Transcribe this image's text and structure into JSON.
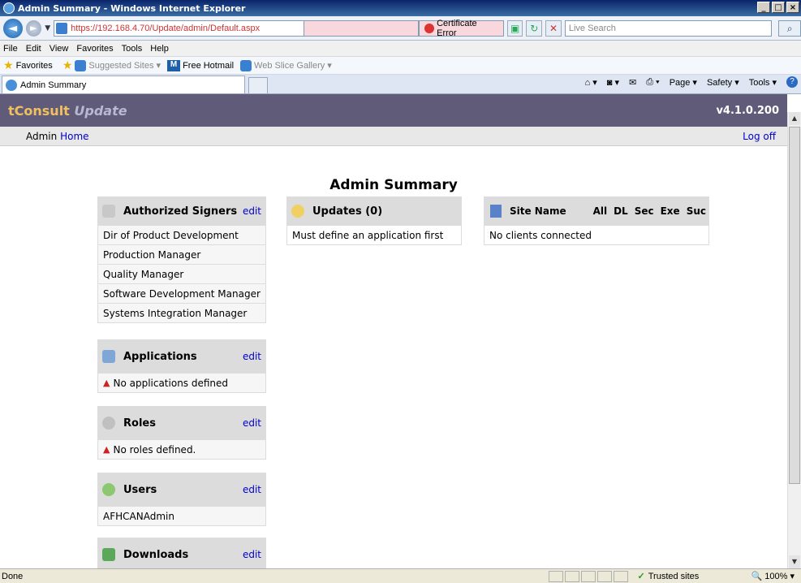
{
  "window": {
    "title": "Admin Summary - Windows Internet Explorer"
  },
  "browser": {
    "url": "https://192.168.4.70/Update/admin/Default.aspx",
    "cert_error": "Certificate Error",
    "search_placeholder": "Live Search",
    "menu": [
      "File",
      "Edit",
      "View",
      "Favorites",
      "Tools",
      "Help"
    ],
    "favorites_label": "Favorites",
    "fav_items": [
      "Suggested Sites ▾",
      "Free Hotmail",
      "Web Slice Gallery ▾"
    ],
    "tab_label": "Admin Summary",
    "cmd_items": [
      "Page ▾",
      "Safety ▾",
      "Tools ▾"
    ]
  },
  "app": {
    "brand": "tConsult",
    "brand_sub": "Update",
    "version": "v4.1.0.200",
    "nav_prefix": "Admin",
    "nav_home": "Home",
    "logoff": "Log off",
    "page_title": "Admin Summary"
  },
  "signers": {
    "title": "Authorized Signers",
    "edit": "edit",
    "items": [
      "Dir of Product Development",
      "Production Manager",
      "Quality Manager",
      "Software Development Manager",
      "Systems Integration Manager"
    ]
  },
  "applications": {
    "title": "Applications",
    "edit": "edit",
    "empty": "No applications defined"
  },
  "roles": {
    "title": "Roles",
    "edit": "edit",
    "empty": "No roles defined."
  },
  "users": {
    "title": "Users",
    "edit": "edit",
    "items": [
      "AFHCANAdmin"
    ]
  },
  "downloads": {
    "title": "Downloads",
    "edit": "edit"
  },
  "updates": {
    "title": "Updates (0)",
    "message": "Must define an application first"
  },
  "sites": {
    "title": "Site Name",
    "columns": [
      "All",
      "DL",
      "Sec",
      "Exe",
      "Suc"
    ],
    "message": "No clients connected"
  },
  "status": {
    "text": "Done",
    "zone": "Trusted sites",
    "zoom": "100%"
  }
}
